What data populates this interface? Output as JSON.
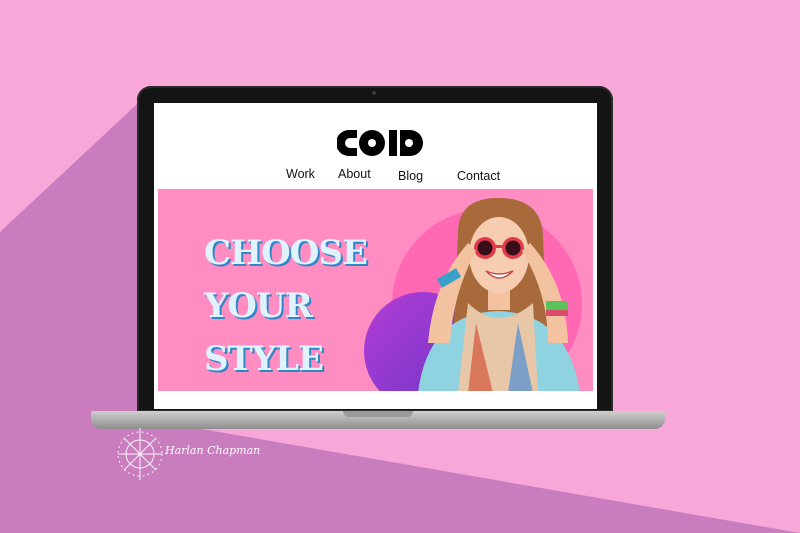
{
  "site": {
    "logo_alt": "COID",
    "nav": [
      {
        "label": "Work"
      },
      {
        "label": "About"
      },
      {
        "label": "Blog"
      },
      {
        "label": "Contact"
      }
    ]
  },
  "hero": {
    "title_lines": [
      "CHOOSE",
      "YOUR",
      "STYLE"
    ]
  },
  "watermark": {
    "signature": "Harlan Chapman"
  },
  "colors": {
    "background": "#f7a8d8",
    "hero_bg": "#ff8dc2",
    "hero_circle": "#ff69b4",
    "hero_circle_purple": "#8a38d0",
    "title_fill": "#dff3ff",
    "title_shadow": "#2d88c7"
  },
  "icons": {
    "logo": "coid-logo-icon",
    "camera": "camera-icon"
  }
}
